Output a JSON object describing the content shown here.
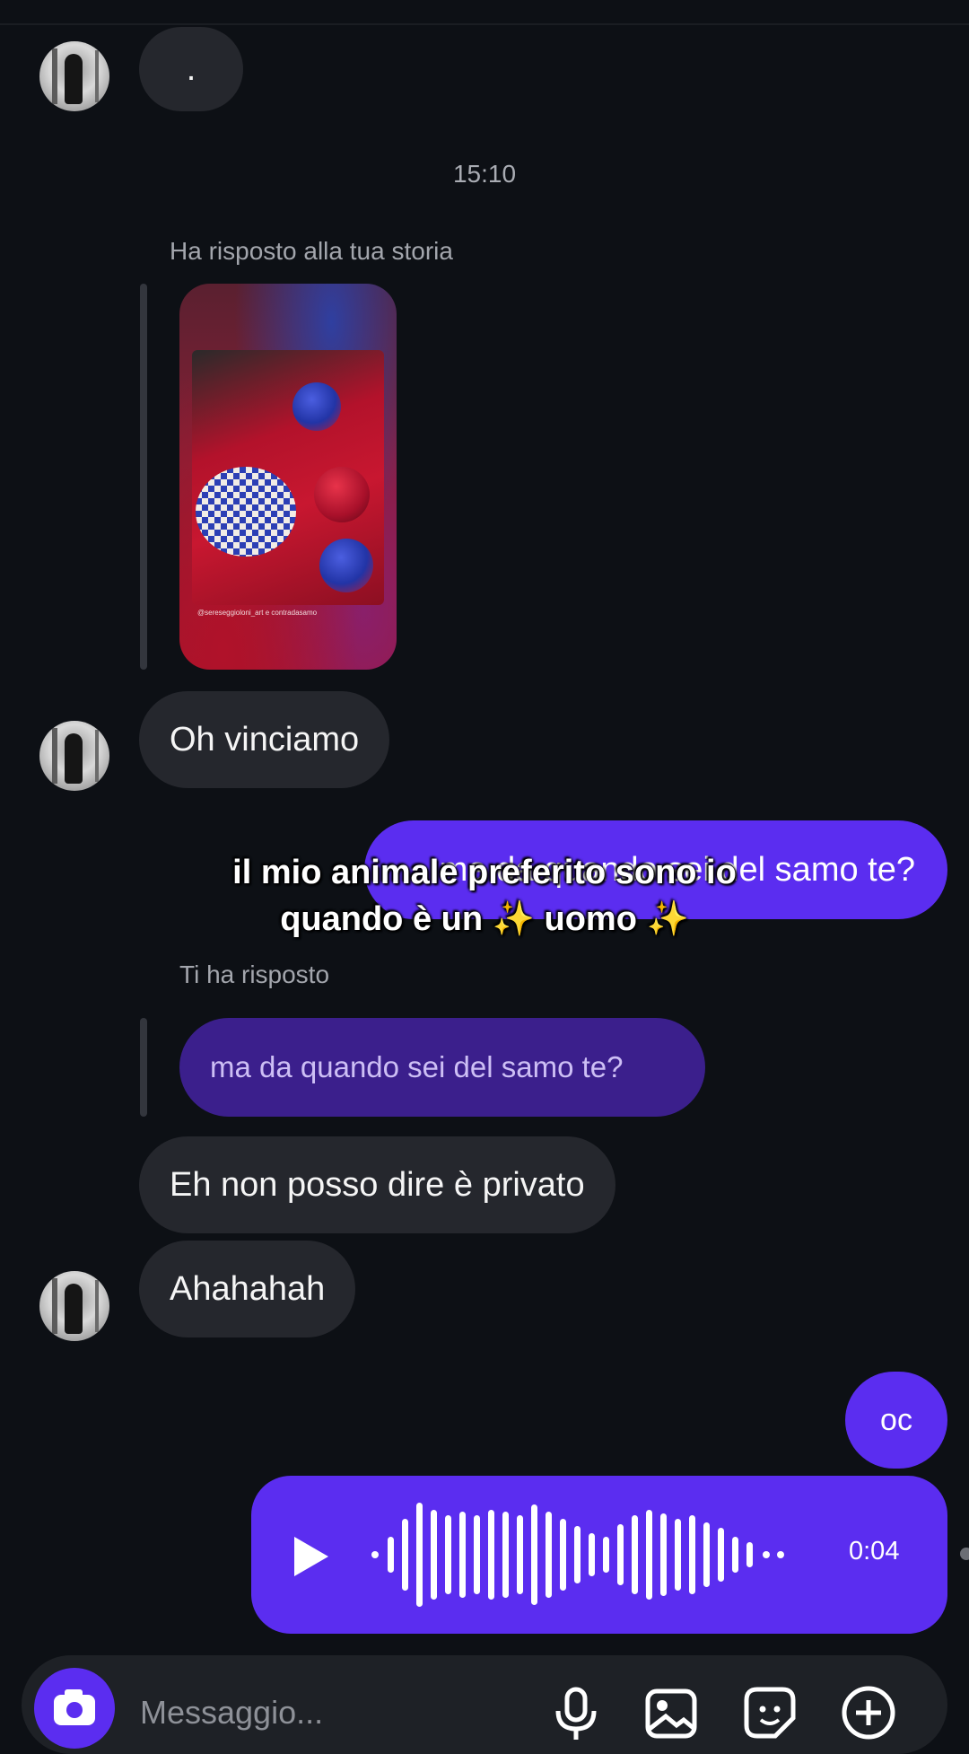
{
  "thread": {
    "first_message": ".",
    "timestamp": "15:10",
    "story_reply_label": "Ha risposto alla tua storia",
    "story_caption": "@sereseggioloni_art e contradasamo",
    "msg_oh": "Oh vinciamo",
    "outgoing_question": "ma da quando sei del samo te?",
    "reply_label": "Ti ha risposto",
    "quoted_message": "ma da quando sei del samo te?",
    "msg_private": "Eh non posso dire è privato",
    "msg_laugh": "Ahahahah",
    "outgoing_oc": "oc",
    "voice_duration": "0:04"
  },
  "overlay": {
    "line1": "il mio animale preferito sono io",
    "line2": "quando è un ✨ uomo ✨"
  },
  "composer": {
    "placeholder": "Messaggio..."
  },
  "icons": [
    "camera-icon",
    "microphone-icon",
    "gallery-icon",
    "sticker-icon",
    "plus-icon",
    "play-icon"
  ],
  "colors": {
    "background": "#0d1015",
    "incoming_bubble": "#25272d",
    "outgoing_bubble": "#5b2df0",
    "quoted_bubble": "#3b1f8c"
  }
}
